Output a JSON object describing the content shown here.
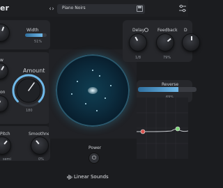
{
  "header": {
    "logo_fragment": "er",
    "prev_icon": "chevron-left-icon",
    "next_icon": "chevron-right-icon",
    "preset_name": "Piano Noirs",
    "save_icon": "save-icon",
    "settings_icon": "sliders-icon"
  },
  "left": {
    "width_label": "Width",
    "width_value": "51%",
    "width_fill": 0.8,
    "label_2": "w",
    "amount_label": "Amount",
    "amount_value": "180",
    "label_3": "on",
    "pitch_label": "Pitch",
    "pitch_value": "semi",
    "smoothness_label": "Smoothness",
    "smoothness_value": "0%"
  },
  "right": {
    "delay_label": "Delay",
    "delay_value": "1/8",
    "feedback_label": "Feedback",
    "feedback_value": "79%",
    "third_label": "D",
    "reverse_label": "Reverse",
    "reverse_value": "69%",
    "reverse_fill": 0.69
  },
  "center": {
    "power_label": "Power",
    "power_icon": "power-icon"
  },
  "footer": {
    "brand_name": "Linear Sounds",
    "brand_icon": "waveform-icon"
  },
  "colors": {
    "accent": "#6fb8e8",
    "eq_line": "#c8cbd0",
    "eq_node_red": "#d9534f",
    "eq_node_green": "#7fd67a"
  }
}
